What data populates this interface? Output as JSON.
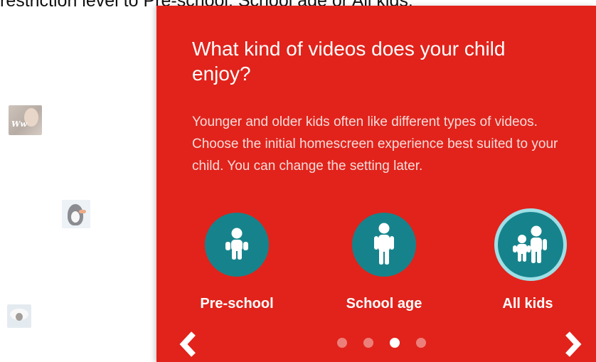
{
  "caption": "restriction level to Pre-school, School age or All kids.",
  "card": {
    "title": "What kind of videos does your child enjoy?",
    "description": "Younger and older kids often like different types of videos. Choose the initial homescreen experience best suited to your child. You can change the setting later."
  },
  "thumbnails": {
    "ww_text": "Ww"
  },
  "options": [
    {
      "label": "Pre-school",
      "icon": "child-icon",
      "selected": false
    },
    {
      "label": "School age",
      "icon": "older-child-icon",
      "selected": false
    },
    {
      "label": "All kids",
      "icon": "kids-group-icon",
      "selected": true
    }
  ],
  "pagination": {
    "count": 4,
    "active_index": 2
  },
  "navigation": {
    "prev": "chevron-left-icon",
    "next": "chevron-right-icon"
  },
  "colors": {
    "card_background": "#e1231b",
    "option_circle": "#16838c",
    "selected_ring": "#9fdfe6",
    "text": "#ffffff"
  }
}
